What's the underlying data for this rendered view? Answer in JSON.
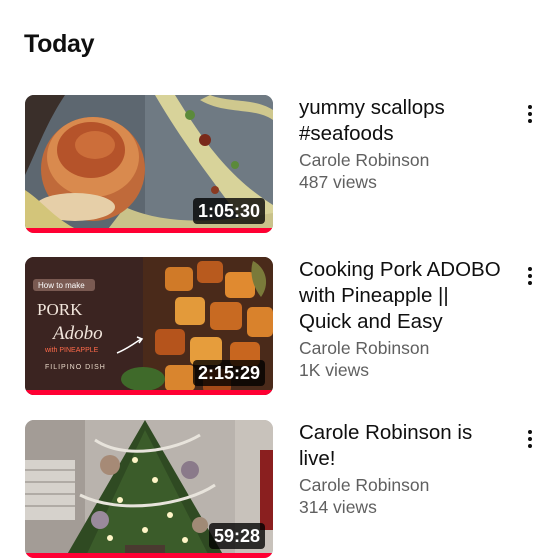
{
  "section": {
    "title": "Today"
  },
  "videos": [
    {
      "title_line1": "yummy scallops",
      "title_line2": "#seafoods",
      "title_line3": "",
      "channel": "Carole Robinson",
      "views": "487 views",
      "duration": "1:05:30",
      "watch_progress": 1.0
    },
    {
      "title_line1": "Cooking Pork ADOBO",
      "title_line2": "with Pineapple ||",
      "title_line3": "Quick and Easy",
      "channel": "Carole Robinson",
      "views": "1K views",
      "duration": "2:15:29",
      "watch_progress": 1.0,
      "thumb_text": {
        "badge": "How to make",
        "dish1": "PORK",
        "dish2": "Adobo",
        "with": "with PINEAPPLE",
        "origin": "FILIPINO DISH"
      }
    },
    {
      "title_line1": "Carole Robinson is",
      "title_line2": "live!",
      "title_line3": "",
      "channel": "Carole Robinson",
      "views": "314 views",
      "duration": "59:28",
      "watch_progress": 1.0
    }
  ],
  "colors": {
    "progress": "#ff0033",
    "meta_text": "#606060"
  },
  "icons": {
    "more": "more-vert-icon"
  }
}
